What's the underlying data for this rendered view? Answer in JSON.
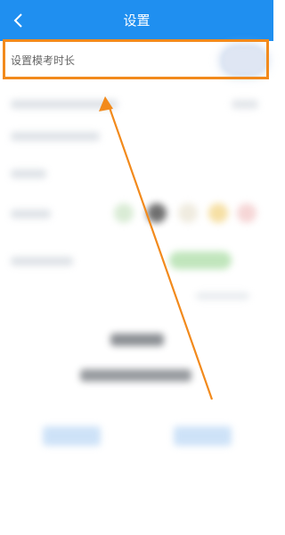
{
  "header": {
    "title": "设置",
    "back_icon": "chevron-left-icon"
  },
  "setting_row": {
    "label": "设置模考时长",
    "toggle_state": "unknown"
  },
  "colors": {
    "header": "#1f8ff0",
    "highlight": "#f28a1c",
    "arrow": "#f28a1c"
  }
}
